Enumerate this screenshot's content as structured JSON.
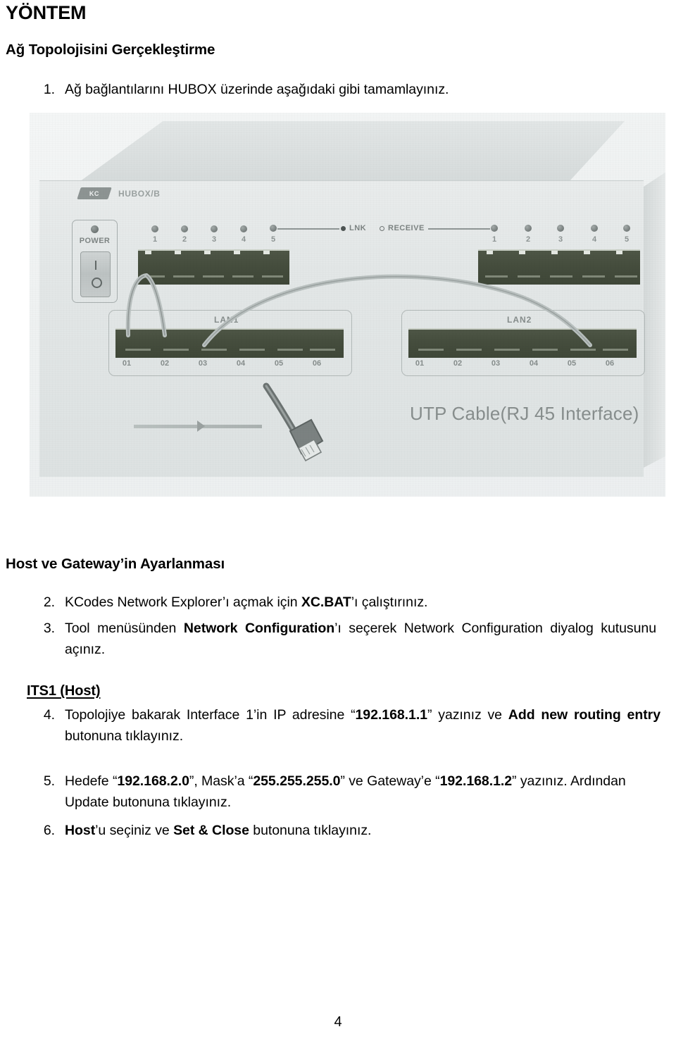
{
  "document": {
    "title": "YÖNTEM",
    "section_heading": "Ağ Topolojisini Gerçekleştirme",
    "section_heading_2": "Host ve Gateway’in Ayarlanması",
    "subsection_heading": "ITS1 (Host)",
    "page_number": "4"
  },
  "steps": {
    "item1": {
      "number": "1.",
      "text": "Ağ bağlantılarını HUBOX üzerinde aşağıdaki gibi tamamlayınız."
    },
    "item2": {
      "number": "2.",
      "part1": "KCodes Network Explorer’ı açmak için ",
      "bold1": "XC.BAT",
      "part2": "’ı çalıştırınız."
    },
    "item3": {
      "number": "3.",
      "part1": "Tool menüsünden ",
      "bold1": "Network Configuration",
      "part2": "’ı seçerek Network Configuration diyalog kutusunu açınız."
    },
    "item4": {
      "number": "4.",
      "part1": "Topolojiye bakarak Interface 1’in IP adresine “",
      "bold1": "192.168.1.1",
      "part2": "” yazınız ve ",
      "bold2": "Add new routing entry",
      "part3": " butonuna tıklayınız."
    },
    "item5": {
      "number": "5.",
      "part1": "Hedefe “",
      "bold1": "192.168.2.0",
      "part2": "”, Mask’a “",
      "bold2": "255.255.255.0",
      "part3": "” ve Gateway’e “",
      "bold3": "192.168.1.2",
      "part4": "” yazınız. Ardından Update butonuna tıklayınız."
    },
    "item6": {
      "number": "6.",
      "bold1": "Host",
      "part1": "’u seçiniz ve ",
      "bold2": "Set & Close",
      "part2": " butonuna tıklayınız."
    }
  },
  "figure": {
    "caption": "UTP Cable(RJ 45 Interface)",
    "brand_logo_text": "KC",
    "model_text": "HUBOX/B",
    "power_label": "POWER",
    "legend": {
      "link_label": "LNK",
      "receive_label": "RECEIVE"
    },
    "top_bank_left": {
      "led_numbers": [
        "1",
        "2",
        "3",
        "4",
        "5"
      ]
    },
    "top_bank_right": {
      "led_numbers": [
        "1",
        "2",
        "3",
        "4",
        "5"
      ]
    },
    "lan1": {
      "title": "LAN1",
      "ports": [
        "01",
        "02",
        "03",
        "04",
        "05",
        "06"
      ]
    },
    "lan2": {
      "title": "LAN2",
      "ports": [
        "01",
        "02",
        "03",
        "04",
        "05",
        "06"
      ]
    }
  },
  "colors": {
    "text": "#000000",
    "photo_bg": "#eef1f1",
    "device_body": "#e4e8e8",
    "port_dark": "#454d3d",
    "label_gray": "#868d8c"
  }
}
